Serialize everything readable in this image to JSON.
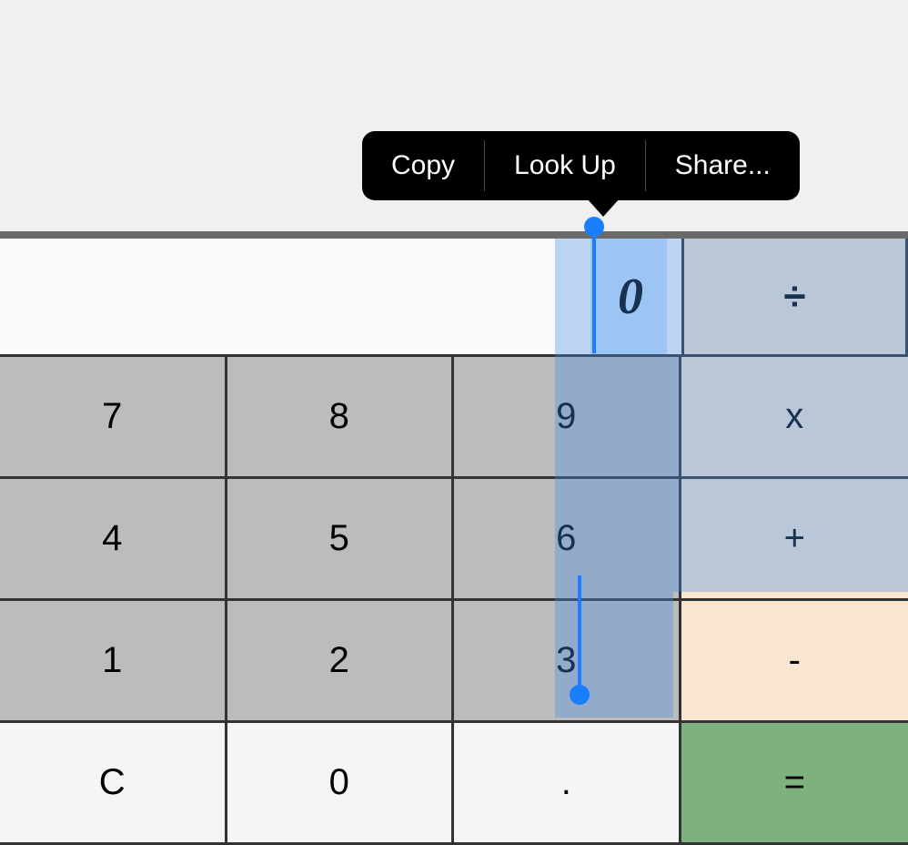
{
  "contextMenu": {
    "copy": "Copy",
    "lookUp": "Look Up",
    "share": "Share..."
  },
  "display": {
    "value": "0"
  },
  "keys": {
    "divide": "÷",
    "seven": "7",
    "eight": "8",
    "nine": "9",
    "multiply": "x",
    "four": "4",
    "five": "5",
    "six": "6",
    "plus": "+",
    "one": "1",
    "two": "2",
    "three": "3",
    "minus": "-",
    "clear": "C",
    "zero": "0",
    "decimal": ".",
    "equals": "="
  }
}
